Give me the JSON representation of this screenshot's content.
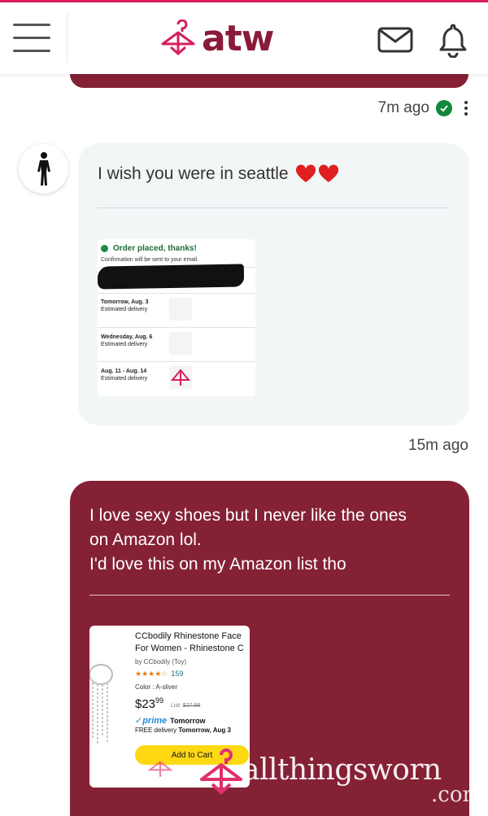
{
  "header": {
    "logo_text": "atw",
    "menu_icon": "hamburger-menu-icon",
    "mail_icon": "envelope-icon",
    "bell_icon": "bell-icon",
    "accent": "#d61f5c",
    "brand": "#8a1b38"
  },
  "messages": [
    {
      "id": "m1",
      "direction": "outgoing",
      "time": "7m ago",
      "status_icon": "check-circle-icon"
    },
    {
      "id": "m2",
      "direction": "incoming",
      "avatar_icon": "person-silhouette-icon",
      "text": "I wish you were in seattle",
      "emoji": "❤️❤️",
      "attachment": {
        "type": "order-screenshot",
        "heading": "Order placed, thanks!",
        "subheading": "Confirmation will be sent to your email.",
        "rows": [
          {
            "date": "Tomorrow, Aug. 3",
            "note": "Estimated delivery"
          },
          {
            "date": "Wednesday, Aug. 6",
            "note": "Estimated delivery"
          },
          {
            "date": "Aug. 11 - Aug. 14",
            "note": "Estimated delivery"
          }
        ]
      },
      "time": "15m ago"
    },
    {
      "id": "m3",
      "direction": "outgoing",
      "lines": [
        "I love sexy shoes but I never like the ones",
        "on Amazon lol.",
        "I'd love this on my Amazon list tho"
      ],
      "attachment": {
        "type": "product-screenshot",
        "title_line1": "CCbodily Rhinestone Face",
        "title_line2": "For Women - Rhinestone C",
        "by": "by CCbodily (Toy)",
        "stars": "★★★★☆",
        "rating_count": "159",
        "color": "Color : A-sliver",
        "price_main": "$23",
        "price_cents": "99",
        "list_label": "List:",
        "list_price": "$27.99",
        "prime_label": "✓prime",
        "prime_delivery": "Tomorrow",
        "free_delivery_prefix": "FREE delivery",
        "free_delivery_date": "Tomorrow, Aug 3",
        "add_to_cart": "Add to Cart"
      }
    }
  ],
  "watermark": {
    "text": "allthingsworn",
    "suffix": ".com"
  },
  "colors": {
    "outgoing_bubble": "#852135",
    "incoming_bubble": "#f3f6f7",
    "check_green": "#11883a"
  }
}
